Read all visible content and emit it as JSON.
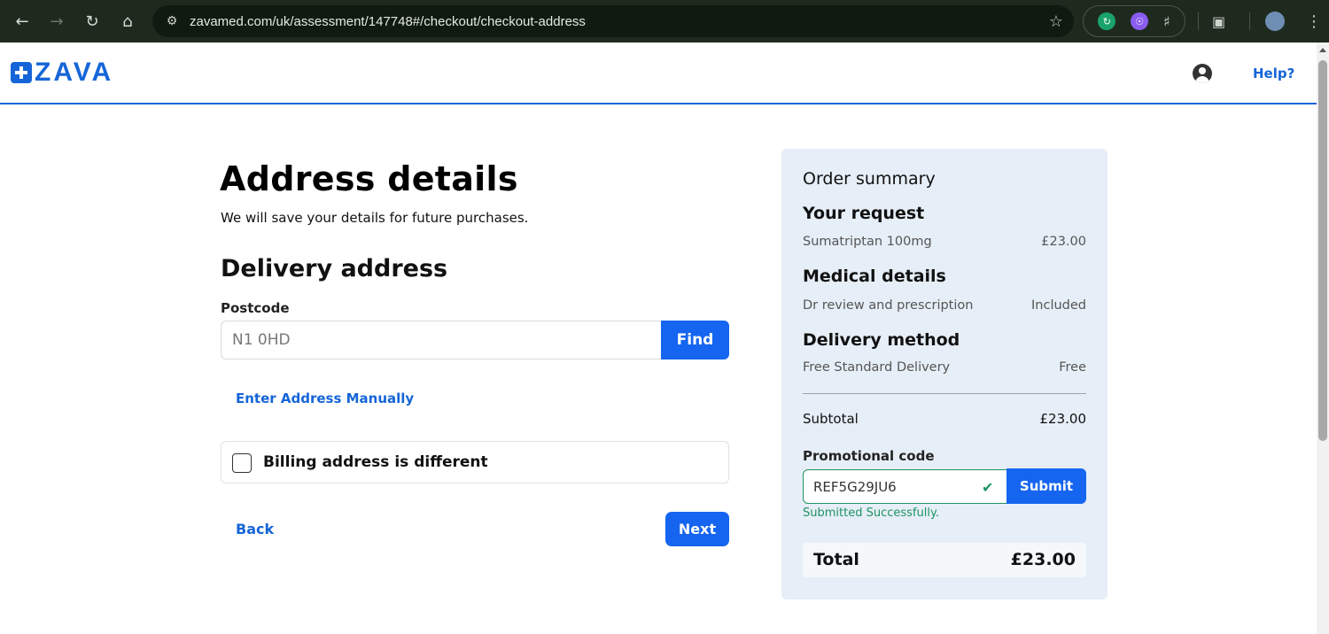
{
  "browser": {
    "url": "zavamed.com/uk/assessment/147748#/checkout/checkout-address",
    "back_icon": "arrow-left-icon",
    "forward_icon": "arrow-right-icon",
    "reload_icon": "reload-icon",
    "home_icon": "home-icon"
  },
  "header": {
    "logo_text": "ZAVA",
    "help_label": "Help?"
  },
  "form": {
    "title": "Address details",
    "subtitle": "We will save your details for future purchases.",
    "section_title": "Delivery address",
    "postcode_label": "Postcode",
    "postcode_placeholder": "N1 0HD",
    "find_label": "Find",
    "manual_link": "Enter Address Manually",
    "billing_label": "Billing address is different",
    "back_label": "Back",
    "next_label": "Next"
  },
  "summary": {
    "title": "Order summary",
    "sections": [
      {
        "heading": "Your request",
        "item": "Sumatriptan 100mg",
        "value": "£23.00"
      },
      {
        "heading": "Medical details",
        "item": "Dr review and prescription",
        "value": "Included"
      },
      {
        "heading": "Delivery method",
        "item": "Free Standard Delivery",
        "value": "Free"
      }
    ],
    "subtotal_label": "Subtotal",
    "subtotal_value": "£23.00",
    "promo_label": "Promotional code",
    "promo_value": "REF5G29JU6",
    "promo_submit": "Submit",
    "promo_status": "Submitted Successfully.",
    "total_label": "Total",
    "total_value": "£23.00"
  },
  "colors": {
    "brand_blue": "#1565d8",
    "button_blue": "#1565f0",
    "success_green": "#1e9463",
    "summary_bg": "#e6eef7"
  }
}
